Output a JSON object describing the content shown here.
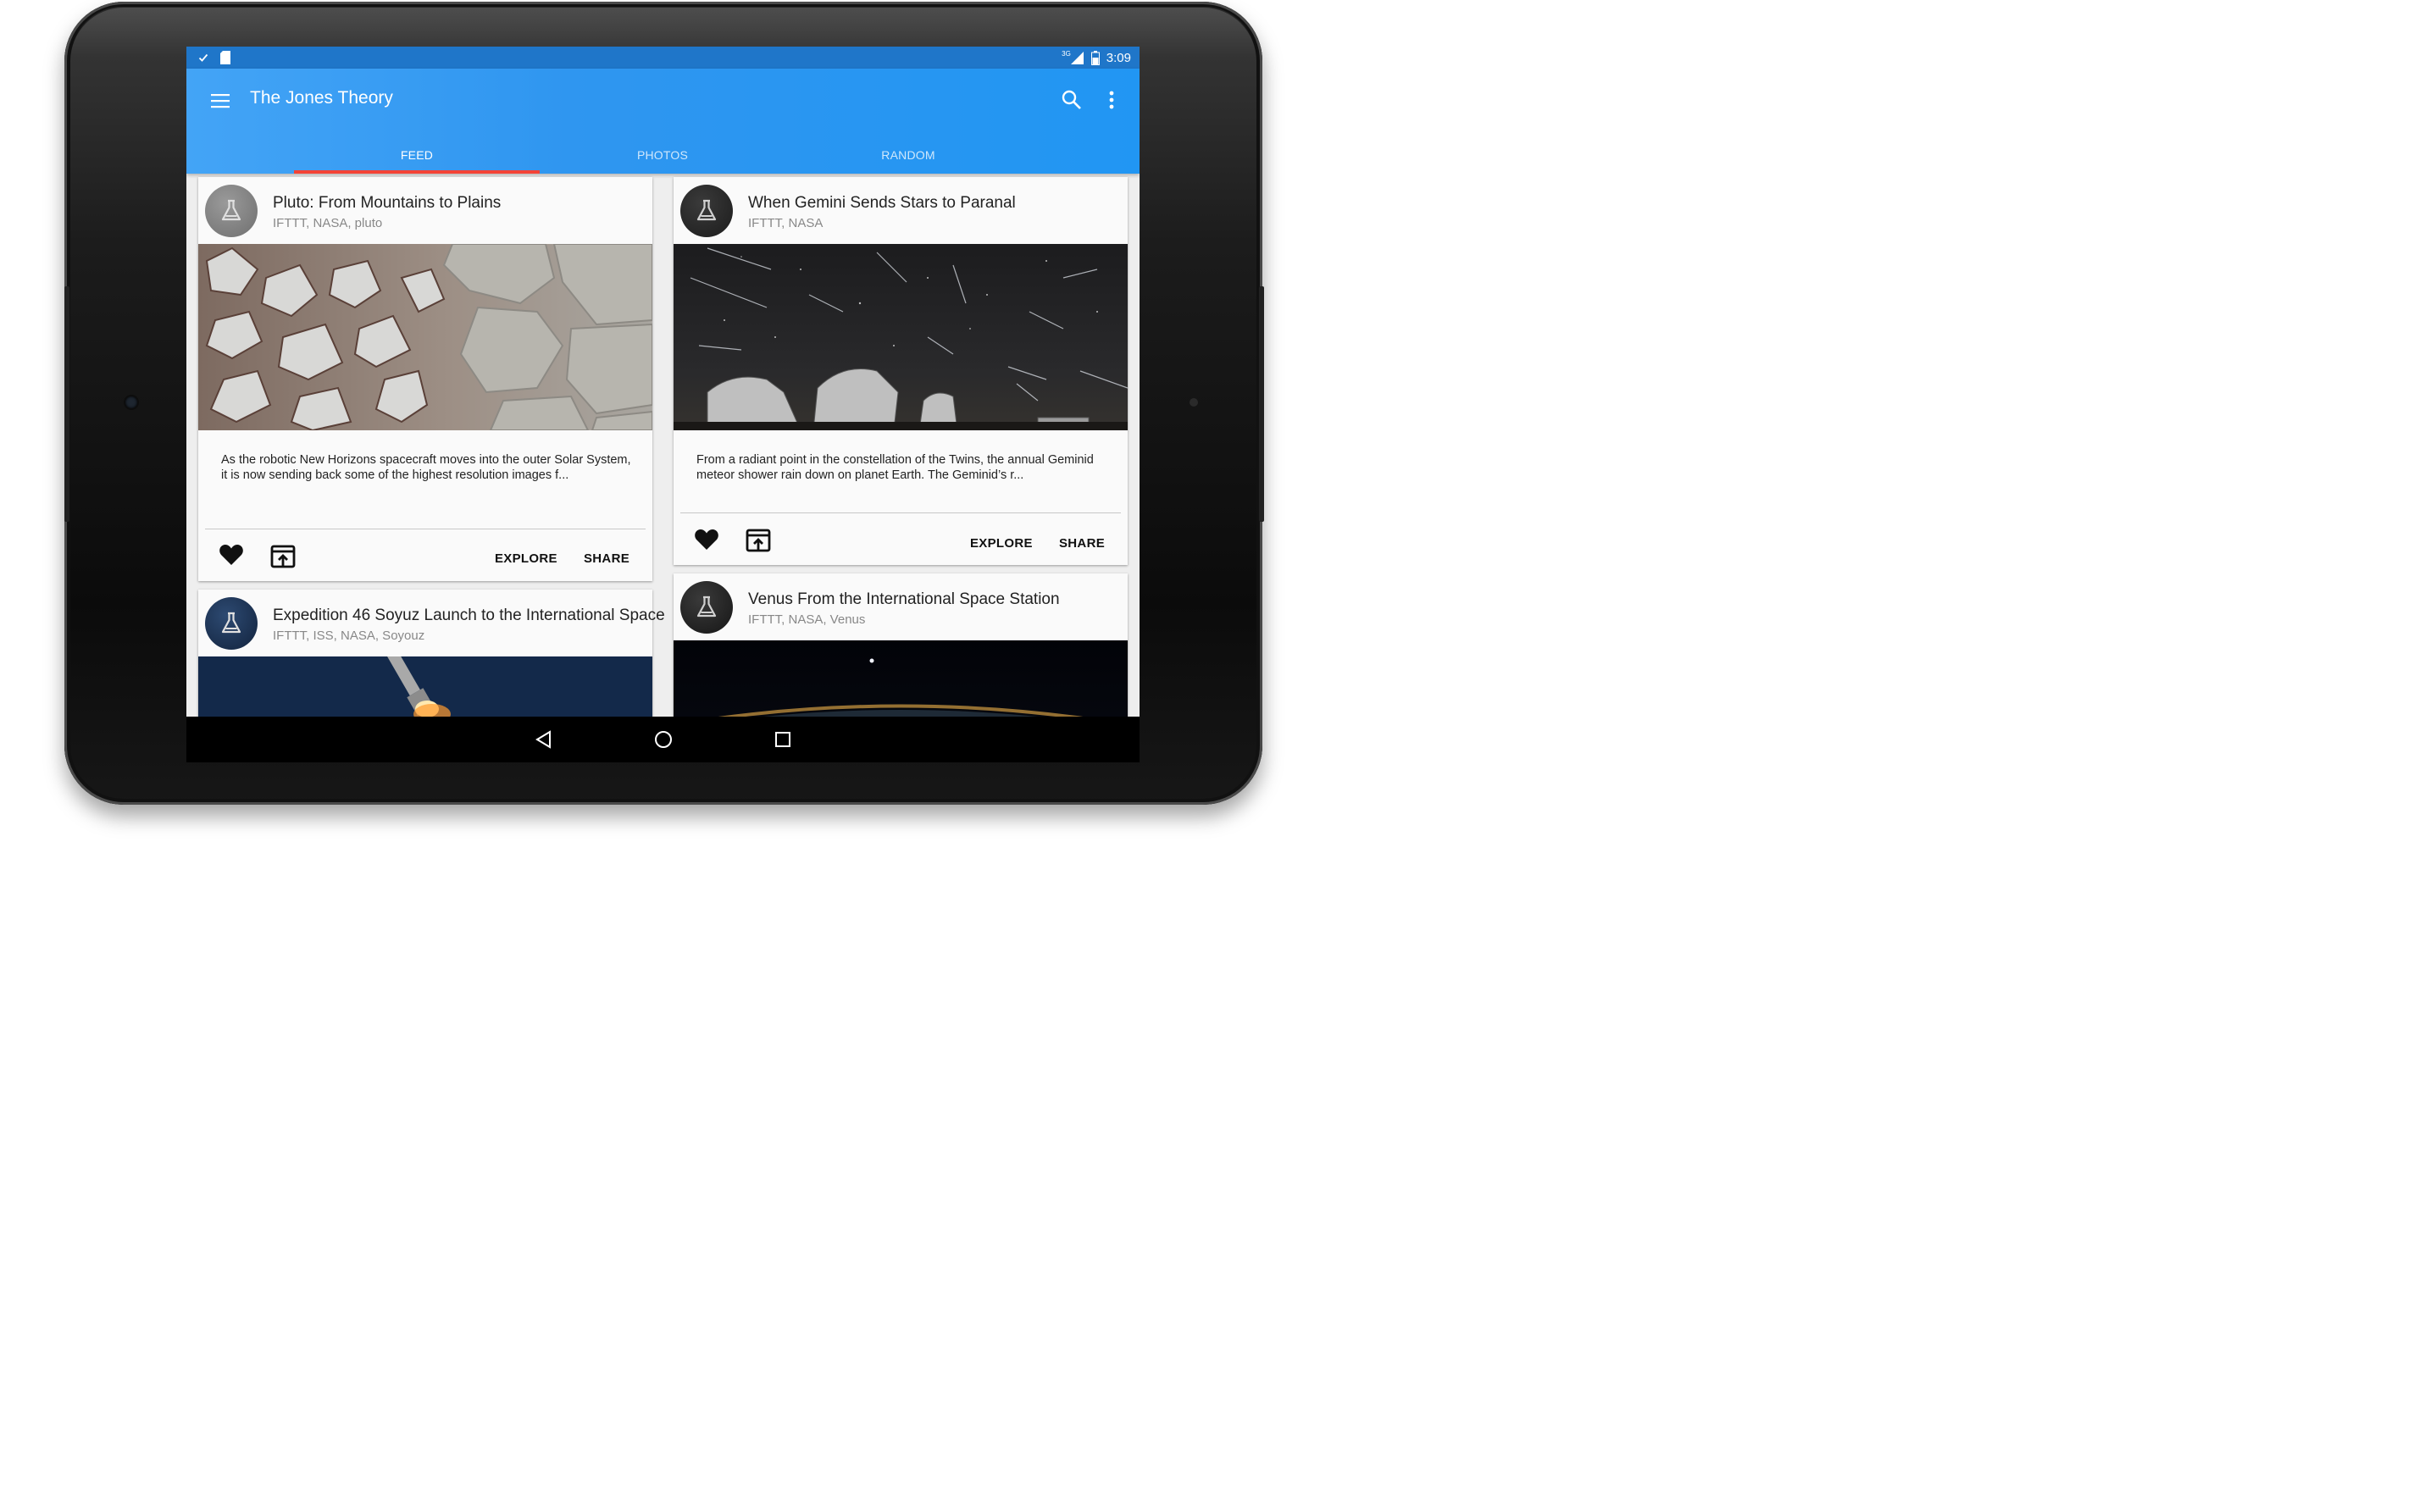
{
  "status_bar": {
    "time": "3:09",
    "network": "3G"
  },
  "app_bar": {
    "title": "The Jones Theory"
  },
  "tabs": [
    {
      "label": "FEED",
      "active": true
    },
    {
      "label": "PHOTOS",
      "active": false
    },
    {
      "label": "RANDOM",
      "active": false
    }
  ],
  "cards": [
    {
      "title": "Pluto: From Mountains to Plains",
      "tags": "IFTTT, NASA, pluto",
      "description": "As the robotic New Horizons spacecraft moves into the outer Solar System, it is now sending back some of the highest resolution images f...",
      "explore_label": "EXPLORE",
      "share_label": "SHARE"
    },
    {
      "title": "When Gemini Sends Stars to Paranal",
      "tags": "IFTTT, NASA",
      "description": "From a radiant point in the constellation of the Twins, the annual Geminid meteor shower rain down on planet Earth. The Geminid’s r...",
      "explore_label": "EXPLORE",
      "share_label": "SHARE"
    },
    {
      "title": "Expedition 46 Soyuz Launch to the International Space",
      "tags": "IFTTT, ISS, NASA, Soyouz"
    },
    {
      "title": "Venus From the International Space Station",
      "tags": "IFTTT, NASA, Venus"
    }
  ],
  "colors": {
    "primary": "#2196f3",
    "status_bar": "#1f76c9",
    "tab_indicator": "#f44336"
  }
}
